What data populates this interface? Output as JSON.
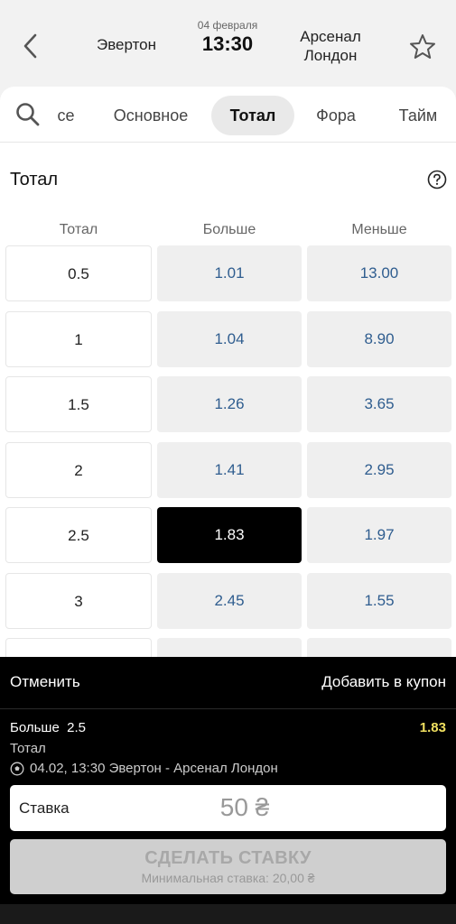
{
  "header": {
    "team_home": "Эвертон",
    "date": "04 февраля",
    "time": "13:30",
    "team_away": "Арсенал Лондон",
    "back_icon": "chevron-left-icon",
    "favorite_icon": "star-outline-icon"
  },
  "tabs": {
    "search_icon": "search-icon",
    "search_tail": "се",
    "items": [
      "Основное",
      "Тотал",
      "Фора",
      "Тайм"
    ],
    "active": "Тотал"
  },
  "market": {
    "title": "Тотал",
    "help_icon": "question-circle-icon",
    "columns": [
      "Тотал",
      "Больше",
      "Меньше"
    ],
    "rows": [
      {
        "line": "0.5",
        "over": "1.01",
        "under": "13.00"
      },
      {
        "line": "1",
        "over": "1.04",
        "under": "8.90"
      },
      {
        "line": "1.5",
        "over": "1.26",
        "under": "3.65"
      },
      {
        "line": "2",
        "over": "1.41",
        "under": "2.95"
      },
      {
        "line": "2.5",
        "over": "1.83",
        "under": "1.97"
      },
      {
        "line": "3",
        "over": "2.45",
        "under": "1.55"
      },
      {
        "line": "",
        "over": "",
        "under": ""
      }
    ],
    "selected": {
      "row": 4,
      "column": "over"
    }
  },
  "slip": {
    "cancel_label": "Отменить",
    "add_coupon_label": "Добавить в купон",
    "pick": "Больше  2.5",
    "odd": "1.83",
    "market": "Тотал",
    "event_icon": "soccer-ball-icon",
    "event": "04.02, 13:30 Эвертон - Арсенал Лондон",
    "stake_label": "Ставка",
    "stake_placeholder": "50 ₴",
    "place_bet_label": "СДЕЛАТЬ СТАВКУ",
    "min_stake_text": "Минимальная ставка: 20,00 ₴",
    "colors": {
      "odd": "#f0e060",
      "background": "#000000"
    }
  }
}
